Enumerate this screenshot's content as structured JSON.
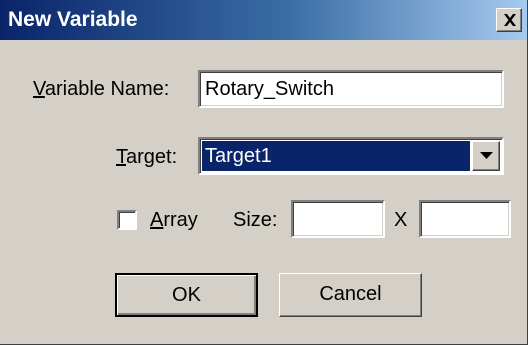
{
  "window": {
    "title": "New Variable",
    "close_icon": "close-icon"
  },
  "variable_name": {
    "label_mnemonic": "V",
    "label_rest": "ariable Name:",
    "value": "Rotary_Switch"
  },
  "target": {
    "label_mnemonic": "T",
    "label_rest": "arget:",
    "selected": "Target1",
    "dropdown_icon": "chevron-down-icon"
  },
  "array": {
    "label_mnemonic": "A",
    "label_rest": "rray",
    "checked": false
  },
  "size": {
    "label": "Size:",
    "separator": "X",
    "rows_value": "",
    "cols_value": ""
  },
  "buttons": {
    "ok_label": "OK",
    "cancel_label": "Cancel"
  },
  "colors": {
    "dialog_bg": "#d4d0c8",
    "title_start": "#0a246a",
    "title_end": "#a6caf0",
    "selection_bg": "#0a246a"
  }
}
